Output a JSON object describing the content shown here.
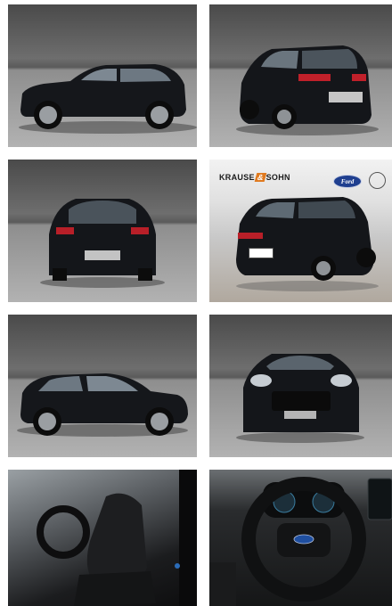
{
  "gallery": {
    "photos": [
      {
        "view": "side-left"
      },
      {
        "view": "rear-three-quarter"
      },
      {
        "view": "rear"
      },
      {
        "view": "showroom-rear-three-quarter"
      },
      {
        "view": "side-right"
      },
      {
        "view": "front"
      },
      {
        "view": "interior-front-seat"
      },
      {
        "view": "dashboard-steering-wheel"
      }
    ]
  },
  "showroom": {
    "dealer_name": "KRAUSE",
    "dealer_name_2": "SOHN",
    "brand_badge": "Ford"
  },
  "colors": {
    "car_body": "#131519",
    "background": "#ffffff"
  }
}
